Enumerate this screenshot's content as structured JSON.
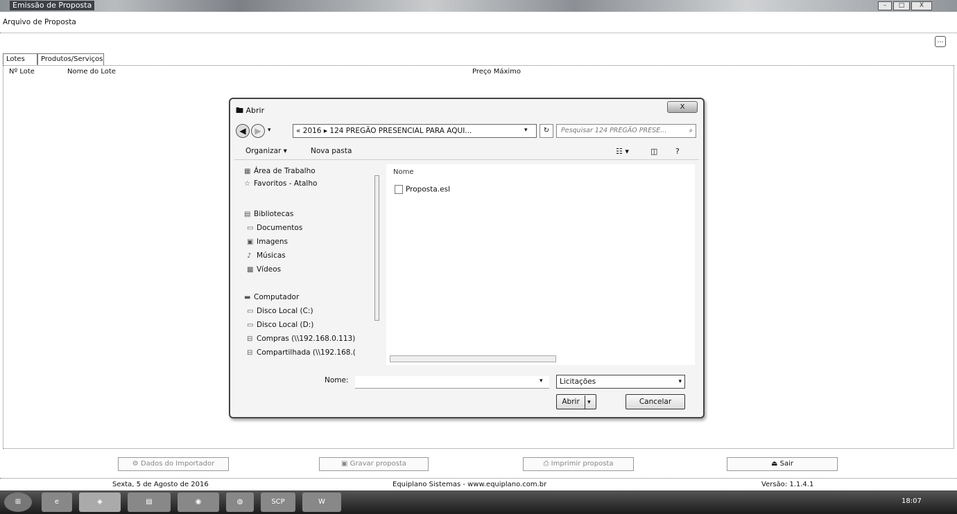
{
  "window": {
    "title": "Emissão de Proposta",
    "minimize": "–",
    "maximize": "□",
    "close": "X"
  },
  "menu": {
    "file": "Arquivo de Proposta"
  },
  "tabs": [
    {
      "label": "Lotes"
    },
    {
      "label": "Produtos/Serviços"
    }
  ],
  "grid": {
    "columns": [
      "Nº Lote",
      "Nome do Lote",
      "Preço Máximo"
    ]
  },
  "dialog": {
    "title": "Abrir",
    "close": "X",
    "address": "« 2016 ▸ 124 PREGÃO PRESENCIAL PARA AQUI...",
    "search_placeholder": "Pesquisar 124 PREGÃO PRESE...",
    "toolbar": {
      "organize": "Organizar ▾",
      "new_folder": "Nova pasta"
    },
    "nav": [
      {
        "icon": "desktop-icon",
        "label": "Área de Trabalho"
      },
      {
        "icon": "star-icon",
        "label": "Favoritos - Atalho"
      },
      {
        "icon": "library-icon",
        "label": "Bibliotecas"
      },
      {
        "icon": "document-icon",
        "label": "Documentos"
      },
      {
        "icon": "image-icon",
        "label": "Imagens"
      },
      {
        "icon": "music-icon",
        "label": "Músicas"
      },
      {
        "icon": "video-icon",
        "label": "Vídeos"
      },
      {
        "icon": "computer-icon",
        "label": "Computador"
      },
      {
        "icon": "disk-icon",
        "label": "Disco Local (C:)"
      },
      {
        "icon": "disk-icon",
        "label": "Disco Local (D:)"
      },
      {
        "icon": "network-drive-icon",
        "label": "Compras (\\\\192.168.0.113)"
      },
      {
        "icon": "network-drive-icon",
        "label": "Compartilhada (\\\\192.168.("
      }
    ],
    "file_header": "Nome",
    "files": [
      {
        "name": "Proposta.esl"
      }
    ],
    "name_label": "Nome:",
    "name_value": "",
    "filetype": "Licitações",
    "open": "Abrir",
    "cancel": "Cancelar"
  },
  "buttons": {
    "importer": "Dados do Importador",
    "save": "Gravar proposta",
    "print": "Imprimir proposta",
    "exit": "Sair"
  },
  "status": {
    "date": "Sexta, 5 de Agosto de 2016",
    "company": "Equiplano Sistemas - www.equiplano.com.br",
    "version": "Versão: 1.1.4.1"
  },
  "taskbar": {
    "clock": "18:07"
  }
}
